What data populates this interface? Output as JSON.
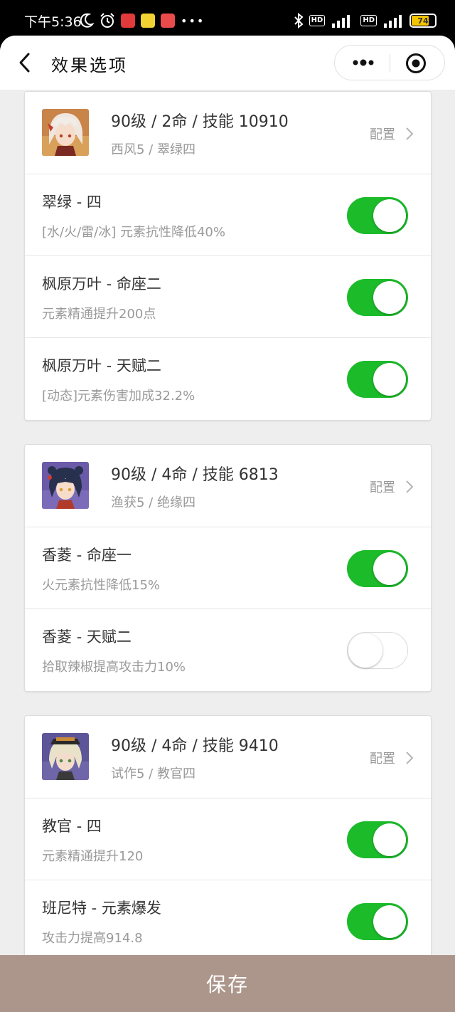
{
  "status_bar": {
    "time": "下午5:36",
    "battery": "74",
    "icons": [
      "moon-icon",
      "alarm-icon",
      "netease-music-icon",
      "58-app-icon",
      "calendar-app-icon",
      "more-dots-icon",
      "bluetooth-icon",
      "hd-icon",
      "signal-icon",
      "battery-icon"
    ]
  },
  "nav": {
    "title": "效果选项"
  },
  "cards": [
    {
      "title": "90级 / 2命 / 技能 10910",
      "subtitle": "西风5 / 翠绿四",
      "config_label": "配置",
      "rows": [
        {
          "title": "翠绿 - 四",
          "desc": "[水/火/雷/冰] 元素抗性降低40%",
          "on": true
        },
        {
          "title": "枫原万叶 - 命座二",
          "desc": "元素精通提升200点",
          "on": true
        },
        {
          "title": "枫原万叶 - 天赋二",
          "desc": "[动态]元素伤害加成32.2%",
          "on": true
        }
      ]
    },
    {
      "title": "90级 / 4命 / 技能 6813",
      "subtitle": "渔获5 / 绝缘四",
      "config_label": "配置",
      "rows": [
        {
          "title": "香菱 - 命座一",
          "desc": "火元素抗性降低15%",
          "on": true
        },
        {
          "title": "香菱 - 天赋二",
          "desc": "拾取辣椒提高攻击力10%",
          "on": false
        }
      ]
    },
    {
      "title": "90级 / 4命 / 技能 9410",
      "subtitle": "试作5 / 教官四",
      "config_label": "配置",
      "rows": [
        {
          "title": "教官 - 四",
          "desc": "元素精通提升120",
          "on": true
        },
        {
          "title": "班尼特 - 元素爆发",
          "desc": "攻击力提高914.8",
          "on": true
        }
      ]
    }
  ],
  "save_button": "保存",
  "colors": {
    "toggle_on": "#1bbb2a",
    "save_bar": "#ac968b"
  }
}
